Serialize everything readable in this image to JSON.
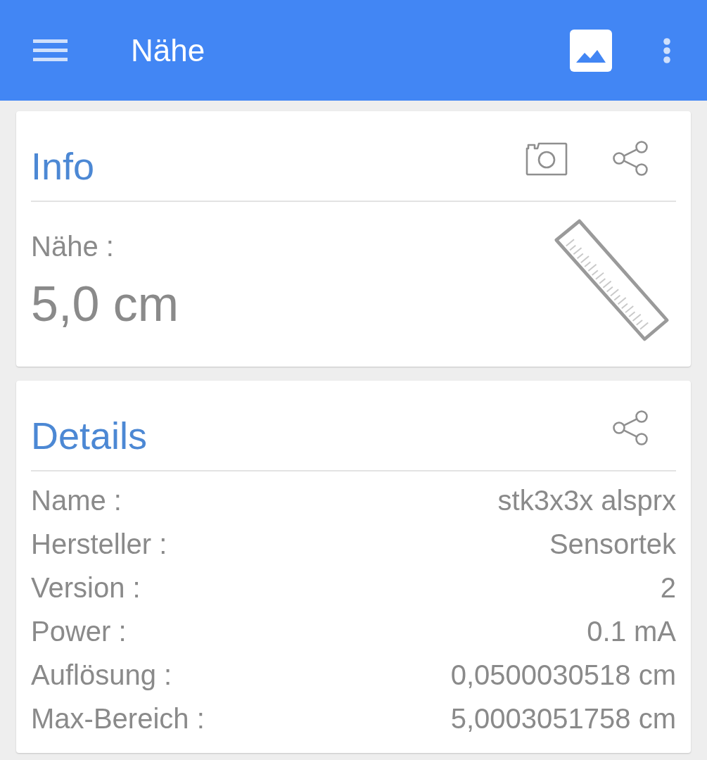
{
  "app_bar": {
    "title": "Nähe"
  },
  "info_card": {
    "title": "Info",
    "label": "Nähe :",
    "value": "5,0 cm"
  },
  "details_card": {
    "title": "Details",
    "rows": [
      {
        "label": "Name :",
        "value": "stk3x3x alsprx"
      },
      {
        "label": "Hersteller :",
        "value": "Sensortek"
      },
      {
        "label": "Version :",
        "value": "2"
      },
      {
        "label": "Power :",
        "value": "0.1 mA"
      },
      {
        "label": "Auflösung :",
        "value": "0,0500030518 cm"
      },
      {
        "label": "Max-Bereich :",
        "value": "5,0003051758 cm"
      }
    ]
  }
}
